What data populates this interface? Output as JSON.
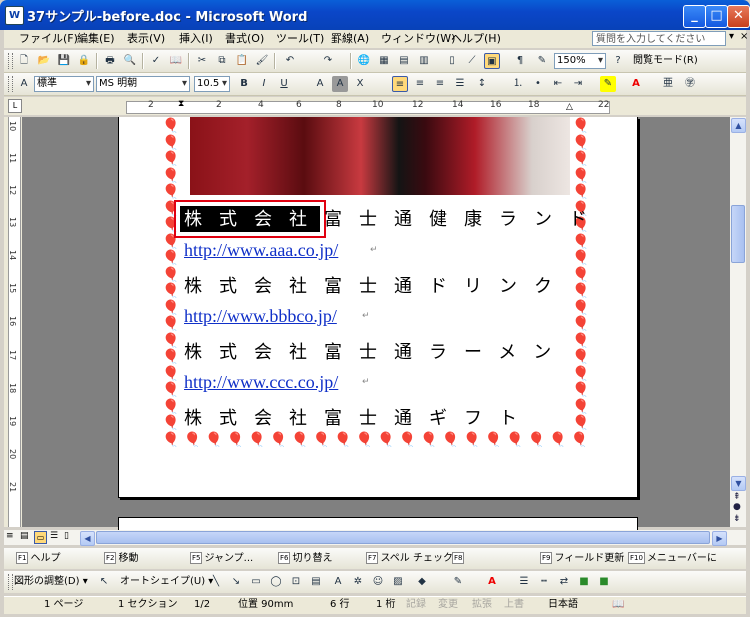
{
  "window": {
    "title": "37サンプル-before.doc - Microsoft Word",
    "app_icon": "word-doc-icon"
  },
  "menu": {
    "items": [
      "ファイル(F)",
      "編集(E)",
      "表示(V)",
      "挿入(I)",
      "書式(O)",
      "ツール(T)",
      "罫線(A)",
      "ウィンドウ(W)",
      "ヘルプ(H)"
    ],
    "ask_placeholder": "質問を入力してください"
  },
  "standard_toolbar": {
    "zoom": "150%",
    "reading_mode": "閲覧モード(R)"
  },
  "format_toolbar": {
    "style": "標準",
    "font": "MS 明朝",
    "size": "10.5"
  },
  "ruler": {
    "h_numbers": [
      "2",
      "2",
      "4",
      "6",
      "8",
      "10",
      "12",
      "14",
      "16",
      "18",
      "20",
      "22"
    ],
    "v_numbers": [
      "10",
      "11",
      "12",
      "13",
      "14",
      "15",
      "16",
      "17",
      "18",
      "19",
      "20",
      "21"
    ]
  },
  "document": {
    "lines": [
      {
        "type": "text",
        "value": "株式会社富士通健康ランド"
      },
      {
        "type": "url",
        "value": "http://www.aaa.co.jp/"
      },
      {
        "type": "text",
        "value": "株式会社富士通ドリンク"
      },
      {
        "type": "url",
        "value": "http://www.bbbco.jp/"
      },
      {
        "type": "text",
        "value": "株式会社富士通ラーメン"
      },
      {
        "type": "url",
        "value": "http://www.ccc.co.jp/"
      },
      {
        "type": "text",
        "value": "株式会社富士通ギフト"
      }
    ],
    "selected_text": "株式会社",
    "selection_highlight": "#e00010",
    "border_icon": "balloon-icon",
    "link_color": "#1030c8"
  },
  "function_keys": [
    {
      "key": "F1",
      "label": "ヘルプ"
    },
    {
      "key": "F2",
      "label": "移動"
    },
    {
      "key": "F5",
      "label": "ジャンプ..."
    },
    {
      "key": "F6",
      "label": "切り替え"
    },
    {
      "key": "F7",
      "label": "スペル チェック..."
    },
    {
      "key": "F8",
      "label": ""
    },
    {
      "key": "F9",
      "label": "フィールド更新"
    },
    {
      "key": "F10",
      "label": "メニューバーに"
    }
  ],
  "drawing_toolbar": {
    "adjust": "図形の調整(D)",
    "autoshape": "オートシェイプ(U)"
  },
  "status": {
    "page": "1 ページ",
    "section": "1 セクション",
    "pages": "1/2",
    "position": "位置 90mm",
    "line": "6 行",
    "column": "1 桁",
    "rec": "記録",
    "trk": "変更",
    "ext": "拡張",
    "ovr": "上書",
    "language": "日本語"
  }
}
